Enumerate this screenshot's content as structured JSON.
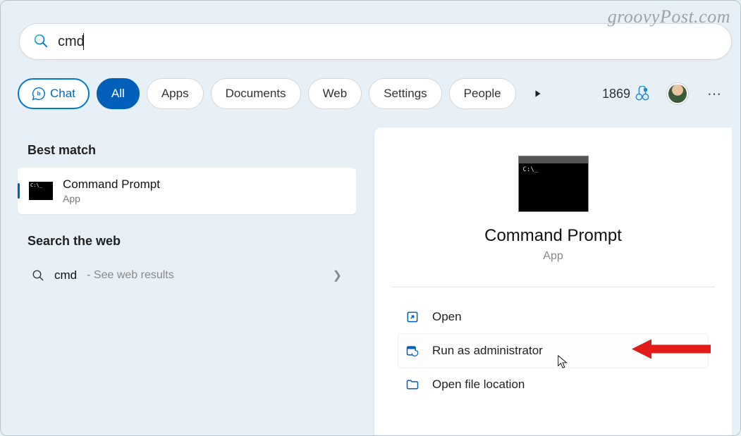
{
  "watermark": "groovyPost.com",
  "search": {
    "query": "cmd"
  },
  "filters": {
    "chat": "Chat",
    "tabs": [
      "All",
      "Apps",
      "Documents",
      "Web",
      "Settings",
      "People"
    ],
    "active_index": 0,
    "points": "1869"
  },
  "left": {
    "section_best": "Best match",
    "result": {
      "title": "Command Prompt",
      "sub": "App"
    },
    "section_web": "Search the web",
    "web_query": "cmd",
    "web_hint": " - See web results"
  },
  "right": {
    "title": "Command Prompt",
    "sub": "App",
    "actions": {
      "open": "Open",
      "admin": "Run as administrator",
      "location": "Open file location"
    }
  }
}
